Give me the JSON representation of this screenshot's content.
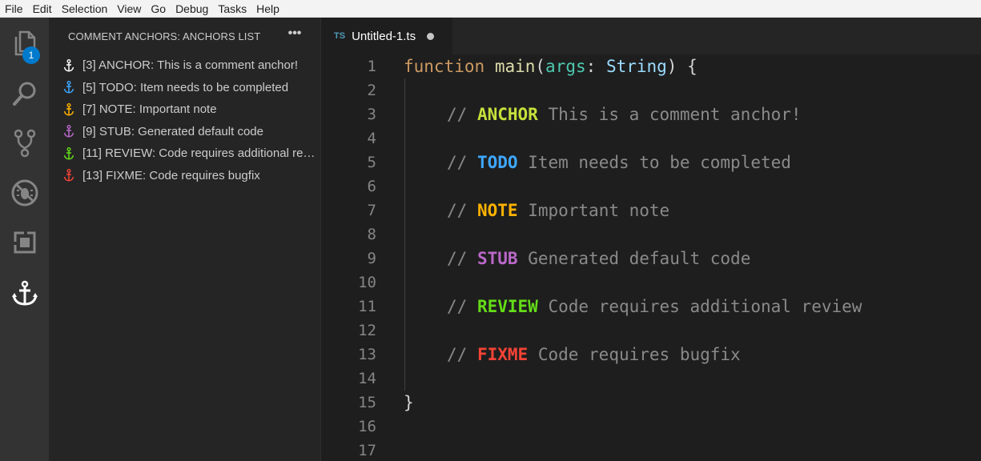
{
  "menu": [
    "File",
    "Edit",
    "Selection",
    "View",
    "Go",
    "Debug",
    "Tasks",
    "Help"
  ],
  "activity_bar": {
    "explorer_badge": "1",
    "icons": [
      "files-icon",
      "search-icon",
      "source-control-icon",
      "debug-icon",
      "extensions-icon",
      "anchor-icon"
    ]
  },
  "sidebar": {
    "title": "COMMENT ANCHORS: ANCHORS LIST",
    "more_label": "•••",
    "anchors": [
      {
        "label": "[3] ANCHOR: This is a comment anchor!",
        "color": "#ffffff"
      },
      {
        "label": "[5] TODO: Item needs to be completed",
        "color": "#3ea8ff"
      },
      {
        "label": "[7] NOTE: Important note",
        "color": "#ffb300"
      },
      {
        "label": "[9] STUB: Generated default code",
        "color": "#ba68c8"
      },
      {
        "label": "[11] REVIEW: Code requires additional review",
        "color": "#64dd17"
      },
      {
        "label": "[13] FIXME: Code requires bugfix",
        "color": "#f44336"
      }
    ]
  },
  "tab": {
    "lang": "TS",
    "title": "Untitled-1.ts"
  },
  "editor": {
    "line_numbers": [
      "1",
      "2",
      "3",
      "4",
      "5",
      "6",
      "7",
      "8",
      "9",
      "10",
      "11",
      "12",
      "13",
      "14",
      "15",
      "16",
      "17"
    ],
    "code": {
      "kw_function": "function",
      "fn_name": "main",
      "open_paren": "(",
      "param": "args",
      "colon": ":",
      "type": "String",
      "close": ") {",
      "close_brace": "}",
      "comment_prefix": "//",
      "comments": [
        {
          "tag": "ANCHOR",
          "text": "This is a comment anchor!",
          "color": "#c6e03b"
        },
        {
          "tag": "TODO",
          "text": "Item needs to be completed",
          "color": "#3ea8ff"
        },
        {
          "tag": "NOTE",
          "text": "Important note",
          "color": "#ffb300"
        },
        {
          "tag": "STUB",
          "text": "Generated default code",
          "color": "#ba68c8"
        },
        {
          "tag": "REVIEW",
          "text": "Code requires additional review",
          "color": "#64dd17"
        },
        {
          "tag": "FIXME",
          "text": "Code requires bugfix",
          "color": "#f44336"
        }
      ]
    }
  }
}
